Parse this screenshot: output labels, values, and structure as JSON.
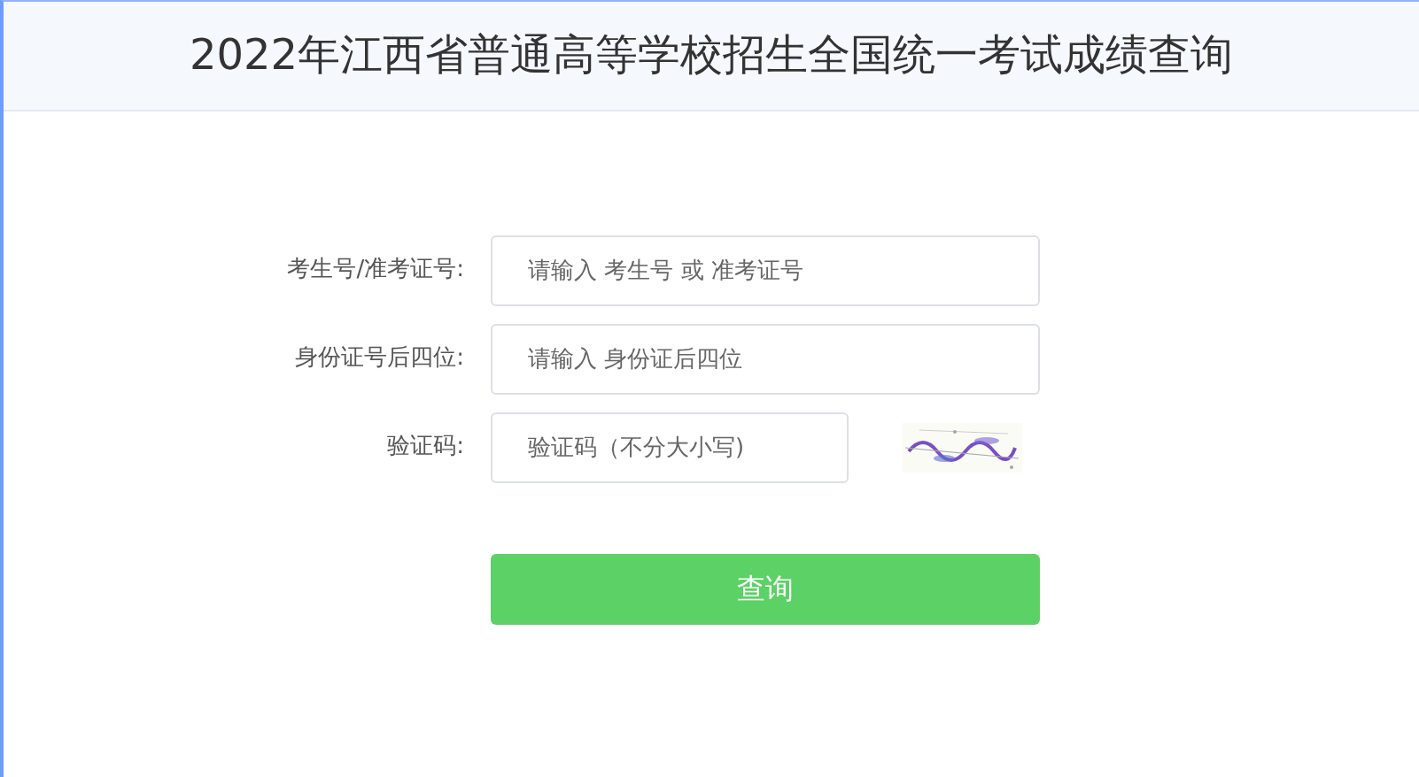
{
  "header": {
    "title": "2022年江西省普通高等学校招生全国统一考试成绩查询"
  },
  "fields": [
    {
      "label": "考生号/准考证号:",
      "placeholder": "请输入 考生号 或 准考证号",
      "kind": "text"
    },
    {
      "label": "身份证号后四位:",
      "placeholder": "请输入 身份证后四位",
      "kind": "text"
    },
    {
      "label": "验证码:",
      "placeholder": "验证码（不分大小写)",
      "kind": "captcha"
    }
  ],
  "submit_button": "查询"
}
